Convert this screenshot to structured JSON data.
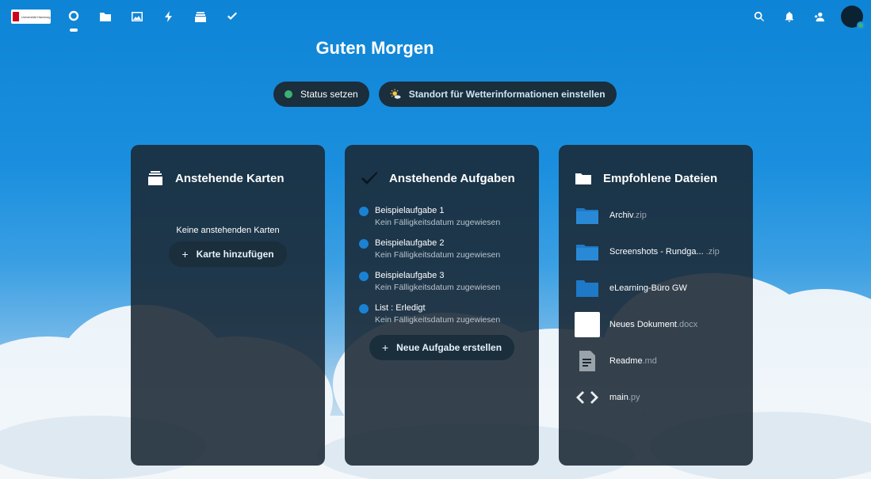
{
  "greeting": "Guten Morgen",
  "status_button": "Status setzen",
  "weather_button": "Standort für Wetterinformationen einstellen",
  "logo_text": "Universität Hamburg",
  "nav_icons": [
    "dashboard-icon",
    "files-icon",
    "photos-icon",
    "activity-icon",
    "deck-icon",
    "tasks-icon"
  ],
  "right_icons": [
    "search-icon",
    "notifications-icon",
    "contacts-icon",
    "avatar"
  ],
  "cards_panel": {
    "title": "Anstehende Karten",
    "empty_text": "Keine anstehenden Karten",
    "add_label": "Karte hinzufügen"
  },
  "tasks_panel": {
    "title": "Anstehende Aufgaben",
    "tasks": [
      {
        "title": "Beispielaufgabe 1",
        "due": "Kein Fälligkeitsdatum zugewiesen"
      },
      {
        "title": "Beispielaufgabe 2",
        "due": "Kein Fälligkeitsdatum zugewiesen"
      },
      {
        "title": "Beispielaufgabe 3",
        "due": "Kein Fälligkeitsdatum zugewiesen"
      },
      {
        "title": "List : Erledigt",
        "due": "Kein Fälligkeitsdatum zugewiesen"
      }
    ],
    "add_label": "Neue Aufgabe erstellen"
  },
  "files_panel": {
    "title": "Empfohlene Dateien",
    "files": [
      {
        "name": "Archiv",
        "ext": ".zip",
        "icon": "zip-icon"
      },
      {
        "name": "Screenshots - Rundga...",
        "ext": " .zip",
        "icon": "zip-icon"
      },
      {
        "name": "eLearning-Büro GW",
        "ext": "",
        "icon": "folder-icon"
      },
      {
        "name": "Neues Dokument",
        "ext": ".docx",
        "icon": "document-preview-icon"
      },
      {
        "name": "Readme",
        "ext": ".md",
        "icon": "text-file-icon"
      },
      {
        "name": "main",
        "ext": ".py",
        "icon": "code-icon"
      }
    ]
  },
  "colors": {
    "sky": "#1b8fde",
    "panel": "#1a2834",
    "pill": "#1a2e3c",
    "status_green": "#3bb273",
    "task_bullet": "#1a82d4"
  }
}
